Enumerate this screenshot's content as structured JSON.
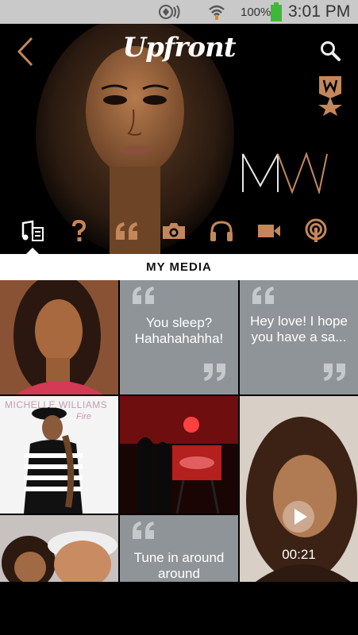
{
  "status_bar": {
    "battery_percent": "100%",
    "time": "3:01 PM",
    "icons": [
      "sync-icon",
      "wifi-icon",
      "battery-icon"
    ]
  },
  "header": {
    "app_title": "Upfront",
    "back_icon": "back-arrow-icon",
    "search_icon": "search-icon",
    "badge_icon": "verified-star-badge-icon",
    "artist_monogram": "MW"
  },
  "tabs": [
    {
      "name": "media",
      "icon": "music-media-icon",
      "active": true
    },
    {
      "name": "questions",
      "icon": "question-icon"
    },
    {
      "name": "quotes",
      "icon": "quote-icon"
    },
    {
      "name": "photos",
      "icon": "camera-icon"
    },
    {
      "name": "audio",
      "icon": "headphones-icon"
    },
    {
      "name": "video",
      "icon": "video-camera-icon"
    },
    {
      "name": "podcast",
      "icon": "podcast-icon"
    }
  ],
  "section_title": "MY MEDIA",
  "grid": {
    "quote_1": "You sleep? Hahahahahha!",
    "quote_2": "Hey love! I hope you have a sa...",
    "quote_3": "Tune in around around",
    "album_title": "MICHELLE WILLIAMS",
    "album_subtitle": "Fire",
    "video_duration": "00:21"
  },
  "colors": {
    "accent": "#c4875a",
    "tile_gray": "#8f9498",
    "status_bar": "#c9c9c9"
  }
}
